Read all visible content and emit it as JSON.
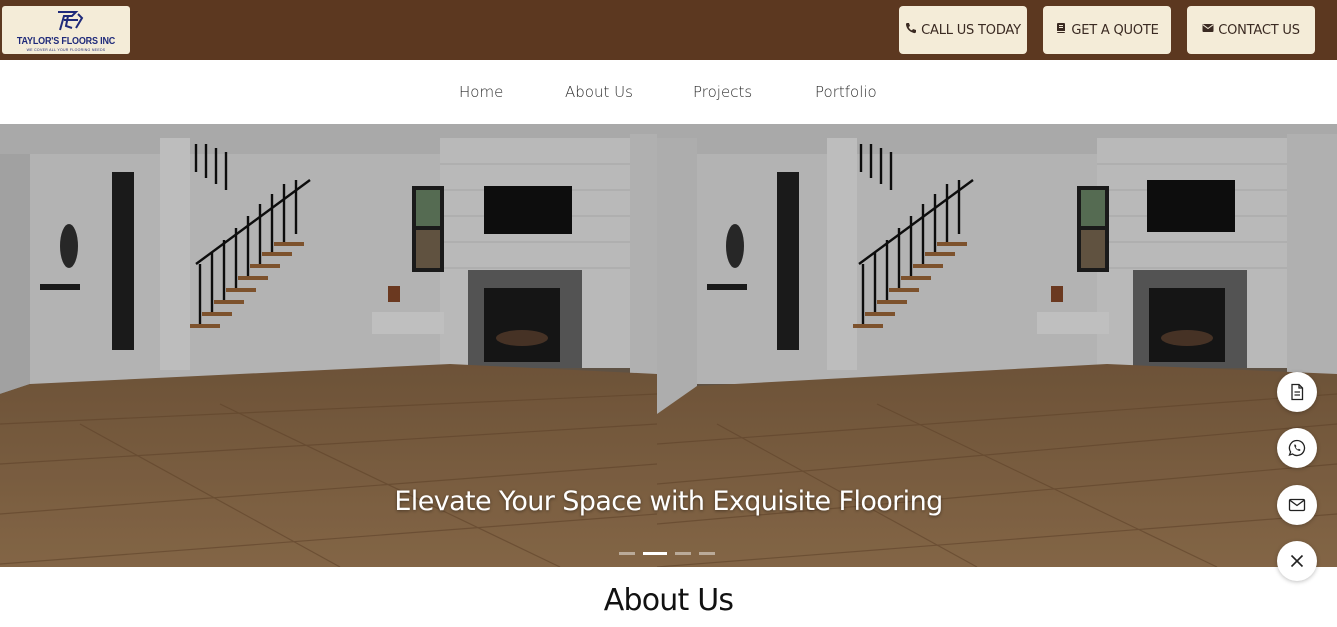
{
  "brand": {
    "name": "TAYLOR'S FLOORS INC",
    "tagline": "WE COVER ALL YOUR FLOORING NEEDS",
    "colors": {
      "topbar": "#5c3820",
      "button_bg": "#f4ecd8",
      "logo_blue": "#1f2a7a"
    }
  },
  "header_buttons": [
    {
      "label": "CALL US TODAY",
      "icon": "phone-icon"
    },
    {
      "label": "GET A QUOTE",
      "icon": "book-icon"
    },
    {
      "label": "CONTACT US",
      "icon": "envelope-icon"
    }
  ],
  "nav": {
    "items": [
      "Home",
      "About Us",
      "Projects",
      "Portfolio"
    ]
  },
  "hero": {
    "title": "Elevate Your Space with Exquisite Flooring",
    "slide_count": 4,
    "active_slide": 2
  },
  "floating_actions": [
    {
      "icon": "document-icon"
    },
    {
      "icon": "whatsapp-icon"
    },
    {
      "icon": "mail-icon"
    },
    {
      "icon": "close-icon"
    }
  ],
  "about": {
    "heading": "About Us"
  }
}
